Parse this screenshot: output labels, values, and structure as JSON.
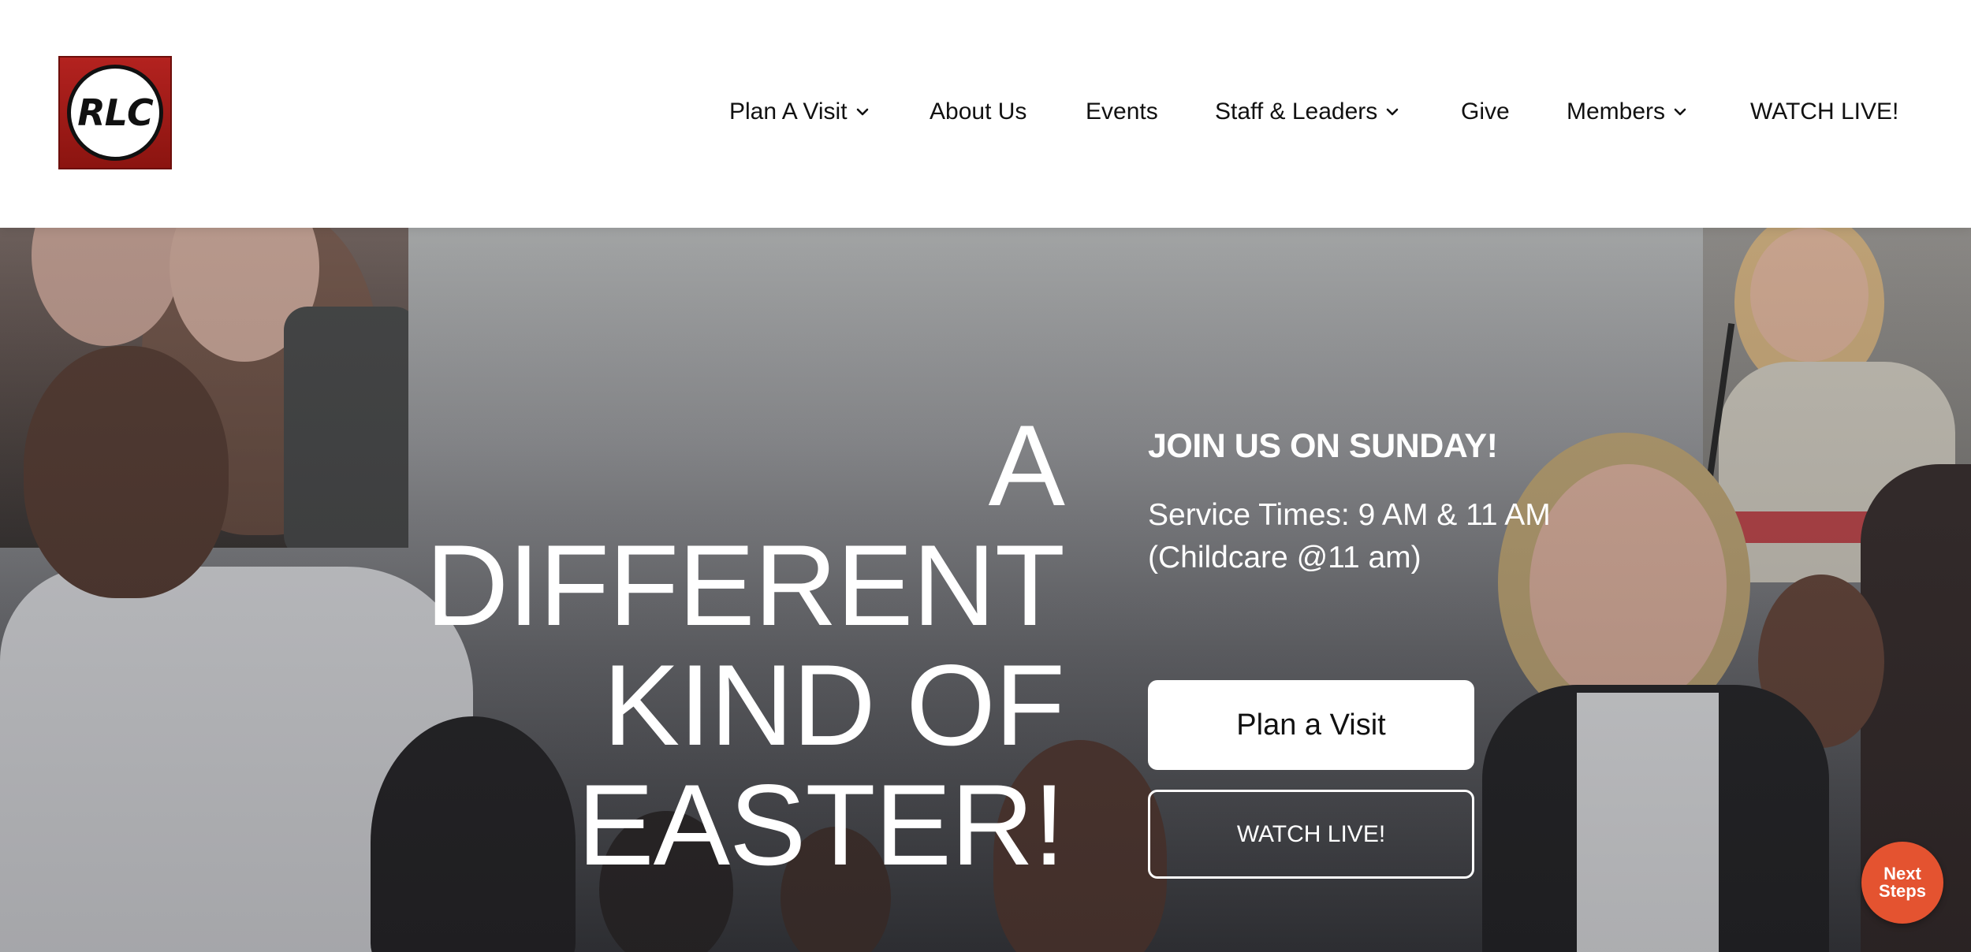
{
  "logo": {
    "text": "RLC"
  },
  "nav": {
    "items": [
      {
        "label": "Plan A Visit",
        "has_dropdown": true
      },
      {
        "label": "About Us",
        "has_dropdown": false
      },
      {
        "label": "Events",
        "has_dropdown": false
      },
      {
        "label": "Staff & Leaders",
        "has_dropdown": true
      },
      {
        "label": "Give",
        "has_dropdown": false
      },
      {
        "label": "Members",
        "has_dropdown": true
      },
      {
        "label": "WATCH LIVE!",
        "has_dropdown": false
      }
    ]
  },
  "hero": {
    "headline_lines": [
      "A",
      "DIFFERENT",
      "KIND OF",
      "EASTER!"
    ],
    "join_heading": "JOIN US ON SUNDAY!",
    "service_times_line1": "Service Times: 9 AM & 11 AM",
    "service_times_line2": "(Childcare @11 am)",
    "plan_visit_button": "Plan a Visit",
    "watch_live_button": "WATCH LIVE!"
  },
  "next_steps": {
    "line1": "Next",
    "line2": "Steps",
    "color": "#e45330"
  },
  "colors": {
    "logo_red": "#b3221f",
    "text_dark": "#111111",
    "hero_text": "#ffffff"
  }
}
